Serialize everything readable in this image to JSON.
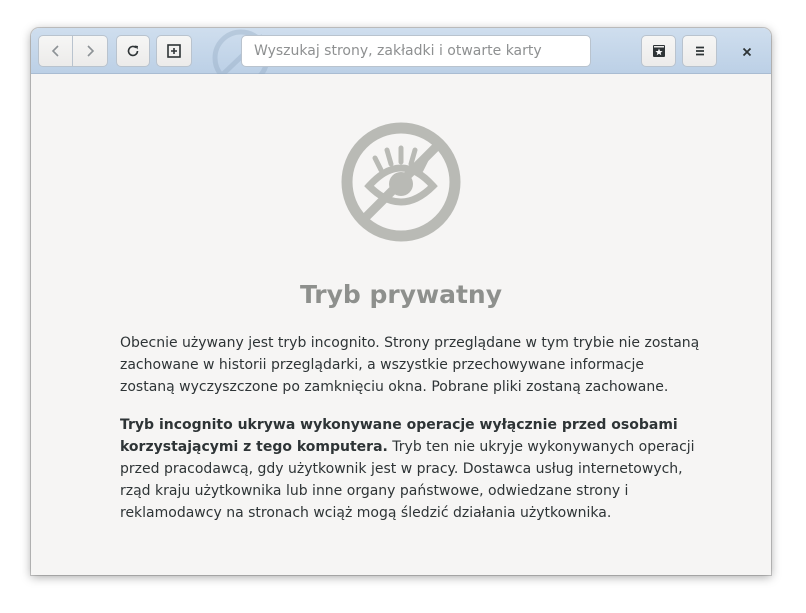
{
  "toolbar": {
    "back_icon": "chevron-left-icon",
    "forward_icon": "chevron-right-icon",
    "reload_icon": "reload-icon",
    "new_tab_icon": "new-tab-icon",
    "search_placeholder": "Wyszukaj strony, zakładki i otwarte karty",
    "bookmarks_icon": "bookmark-star-icon",
    "menu_icon": "hamburger-menu-icon",
    "close_icon": "close-icon"
  },
  "main": {
    "title": "Tryb prywatny",
    "paragraph1": "Obecnie używany jest tryb incognito. Strony przeglądane w tym trybie nie zostaną zachowane w historii przeglądarki, a wszystkie przechowywane informacje zostaną wyczyszczone po zamknięciu okna. Pobrane pliki zostaną zachowane.",
    "paragraph2_bold": "Tryb incognito ukrywa wykonywane operacje wyłącznie przed osobami korzystającymi z tego komputera.",
    "paragraph2_rest": " Tryb ten nie ukryje wykonywanych operacji przed pracodawcą, gdy użytkownik jest w pracy. Dostawca usług internetowych, rząd kraju użytkownika lub inne organy państwowe, odwiedzane strony i reklamodawcy na stronach wciąż mogą śledzić działania użytkownika."
  },
  "colors": {
    "headerbar": "#c4d6ea",
    "background": "#f6f5f4",
    "icon": "#b9bab5",
    "title": "#8e908d",
    "text": "#2e3436"
  }
}
